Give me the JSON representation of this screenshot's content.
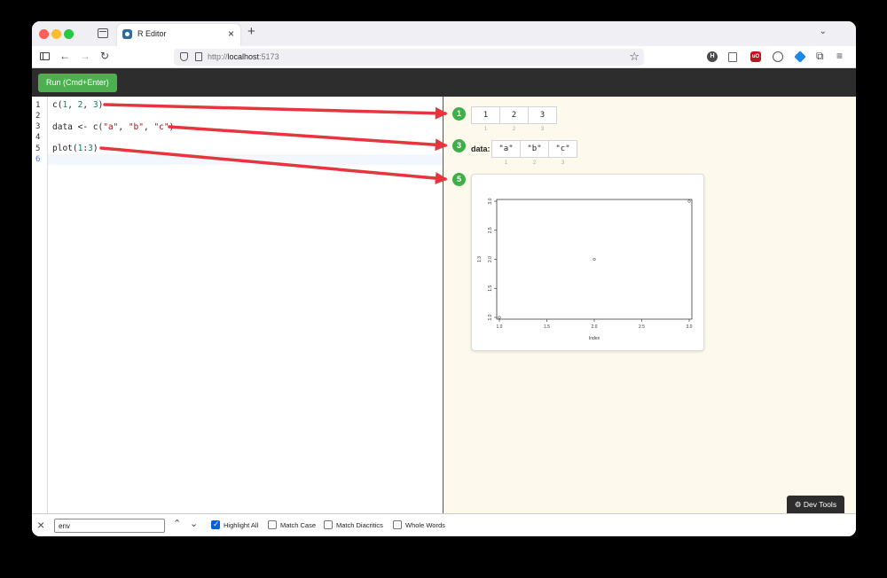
{
  "browser": {
    "tab_title": "R Editor",
    "url_prefix": "http://",
    "url_host": "localhost",
    "url_suffix": ":5173",
    "extensions": [
      "H",
      "uO"
    ]
  },
  "toolbar": {
    "run_label": "Run (Cmd+Enter)"
  },
  "editor": {
    "line_numbers": [
      "1",
      "2",
      "3",
      "4",
      "5",
      "6"
    ],
    "active_line": "6"
  },
  "output": {
    "results": [
      {
        "line": "1",
        "label": "",
        "values": [
          "1",
          "2",
          "3"
        ],
        "indices": [
          "1",
          "2",
          "3"
        ]
      },
      {
        "line": "3",
        "label": "data:",
        "values": [
          "\"a\"",
          "\"b\"",
          "\"c\""
        ],
        "indices": [
          "1",
          "2",
          "3"
        ]
      },
      {
        "line": "5",
        "label": "",
        "values": [],
        "indices": []
      }
    ]
  },
  "chart_data": {
    "type": "scatter",
    "x": [
      1,
      2,
      3
    ],
    "y": [
      1,
      2,
      3
    ],
    "xlabel": "Index",
    "ylabel": "1:3",
    "xlim": [
      1,
      3
    ],
    "ylim": [
      1,
      3
    ],
    "xticks": [
      "1.0",
      "1.5",
      "2.0",
      "2.5",
      "3.0"
    ],
    "yticks": [
      "1.0",
      "1.5",
      "2.0",
      "2.5",
      "3.0"
    ],
    "grid": false
  },
  "dev_tools": {
    "label": "⚙ Dev Tools"
  },
  "findbar": {
    "query": "env",
    "highlight_all": "Highlight All",
    "match_case": "Match Case",
    "match_diacritics": "Match Diacritics",
    "whole_words": "Whole Words"
  },
  "colors": {
    "accent": "#4caf50",
    "badge": "#3fae49",
    "arrow": "#e8343c",
    "output_bg": "#fdf9ec"
  }
}
